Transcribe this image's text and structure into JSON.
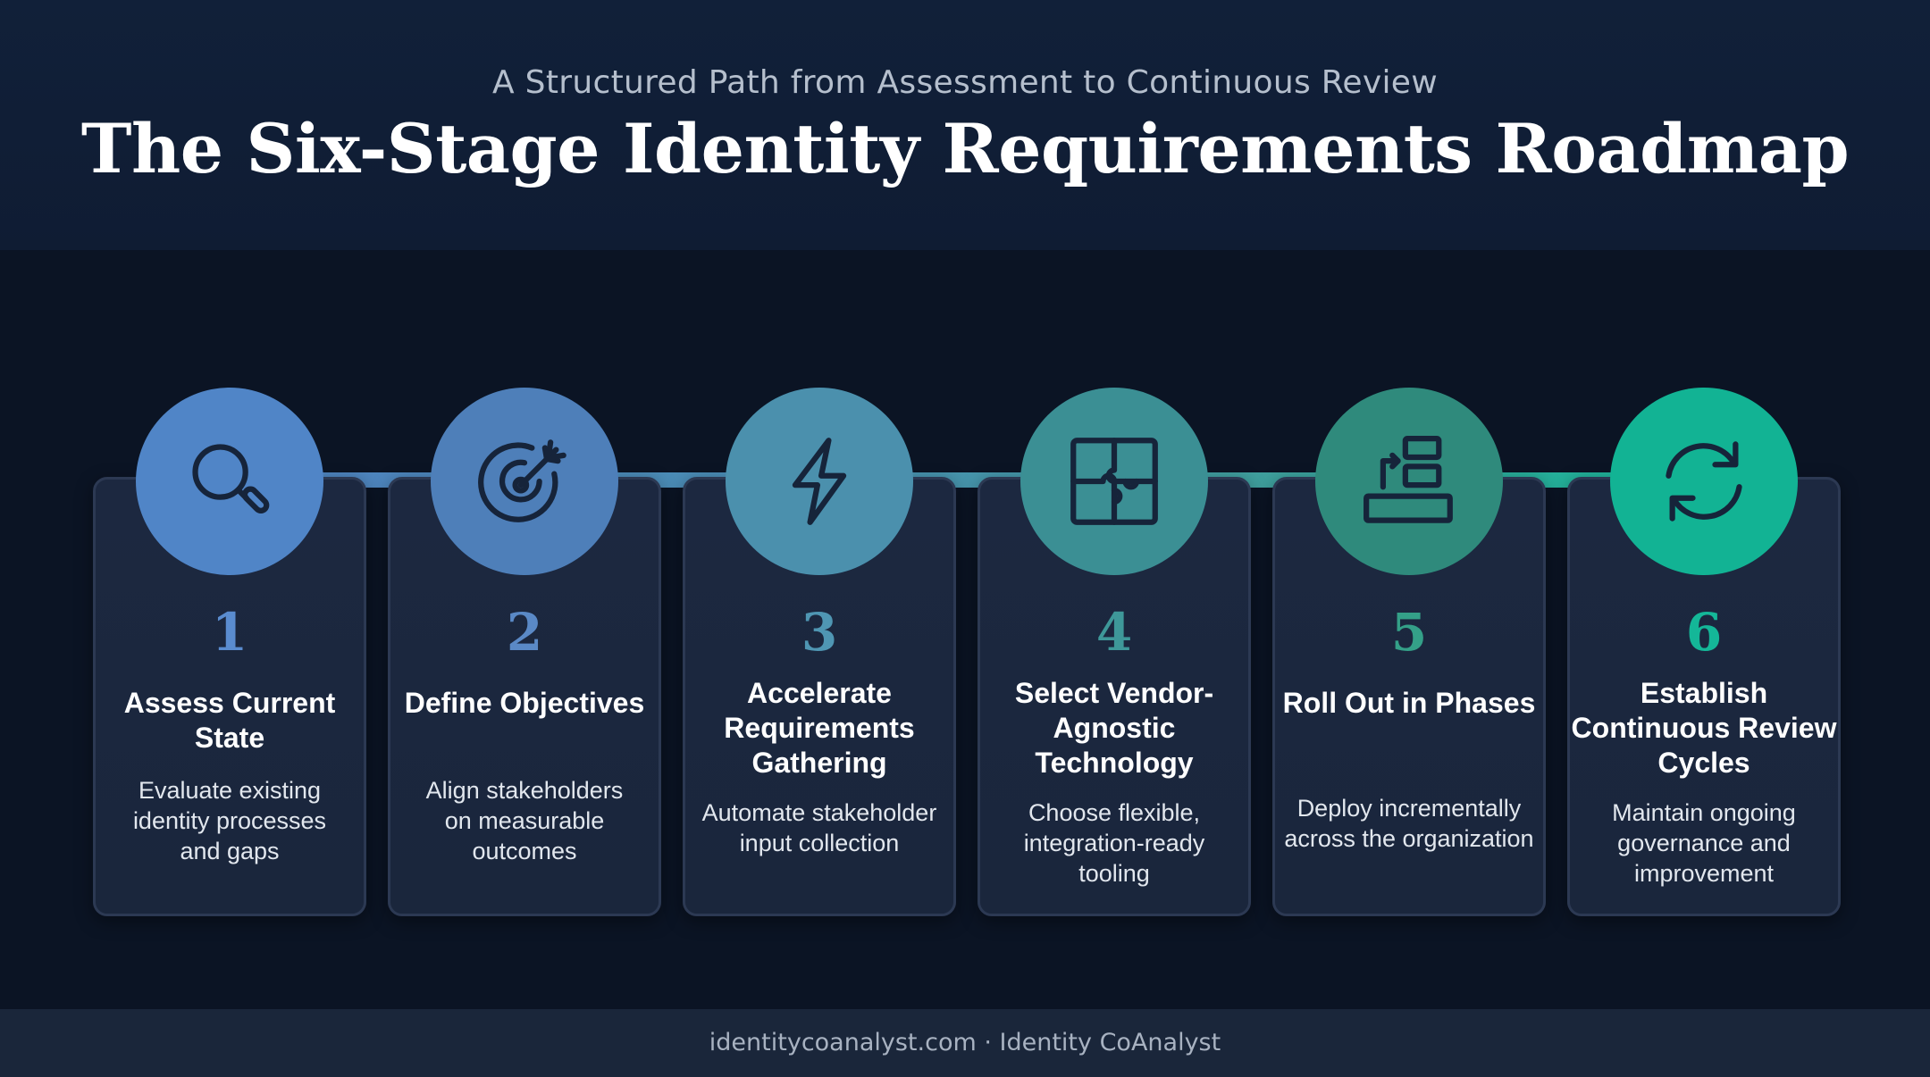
{
  "header": {
    "subtitle": "A Structured Path from Assessment to Continuous Review",
    "title": "The Six-Stage Identity Requirements Roadmap"
  },
  "stages": [
    {
      "number": "1",
      "title": "Assess Current State",
      "description": "Evaluate existing identity processes and gaps",
      "icon": "magnifying-glass-icon",
      "color": "#5085c7",
      "number_color": "#5a8ccf"
    },
    {
      "number": "2",
      "title": "Define Objectives",
      "description": "Align stakeholders on measurable outcomes",
      "icon": "target-arrow-icon",
      "color": "#4e7fb9",
      "number_color": "#5a89c6"
    },
    {
      "number": "3",
      "title": "Accelerate Requirements Gathering",
      "description": "Automate stakeholder input collection",
      "icon": "lightning-bolt-icon",
      "color": "#4b90ad",
      "number_color": "#4f96b3"
    },
    {
      "number": "4",
      "title": "Select Vendor-Agnostic Technology",
      "description": "Choose flexible, integration-ready tooling",
      "icon": "puzzle-pieces-icon",
      "color": "#3b8f94",
      "number_color": "#3e9899"
    },
    {
      "number": "5",
      "title": "Roll Out in Phases",
      "description": "Deploy incrementally across the organization",
      "icon": "phased-deploy-icon",
      "color": "#2f8a7c",
      "number_color": "#34a088"
    },
    {
      "number": "6",
      "title": "Establish Continuous Review Cycles",
      "description": "Maintain ongoing governance and improvement",
      "icon": "refresh-cycle-icon",
      "color": "#12b394",
      "number_color": "#14b798"
    }
  ],
  "footer": {
    "text": "identitycoanalyst.com · Identity CoAnalyst"
  }
}
